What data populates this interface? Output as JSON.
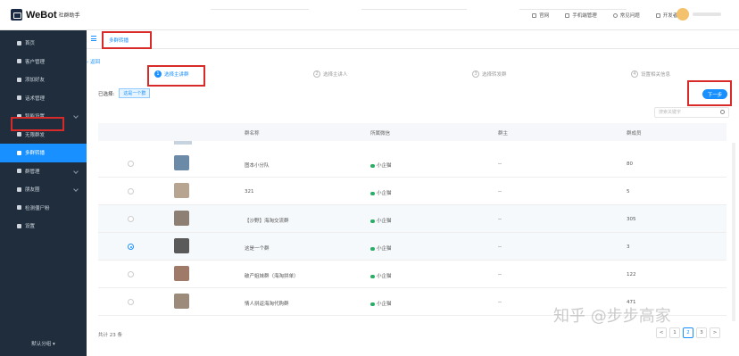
{
  "app": {
    "name": "WeBot",
    "subtitle": "社群助手"
  },
  "top_links": [
    {
      "icon": "monitor-icon",
      "label": "官网"
    },
    {
      "icon": "phone-icon",
      "label": "手机端管理"
    },
    {
      "icon": "question-icon",
      "label": "常见问题"
    },
    {
      "icon": "code-icon",
      "label": "开发者API"
    }
  ],
  "sidebar": {
    "items": [
      {
        "label": "首页",
        "icon": "home-icon",
        "chevron": false
      },
      {
        "label": "客户管理",
        "icon": "user-icon",
        "chevron": false
      },
      {
        "label": "添加好友",
        "icon": "add-friend-icon",
        "chevron": false
      },
      {
        "label": "话术管理",
        "icon": "doc-icon",
        "chevron": false
      },
      {
        "label": "智能设置",
        "icon": "settings-icon",
        "chevron": true
      },
      {
        "label": "无限群发",
        "icon": "send-icon",
        "chevron": false
      },
      {
        "label": "多群转播",
        "icon": "broadcast-icon",
        "chevron": false,
        "active": true
      },
      {
        "label": "群管理",
        "icon": "group-icon",
        "chevron": true
      },
      {
        "label": "朋友圈",
        "icon": "moments-icon",
        "chevron": true
      },
      {
        "label": "检测僵尸粉",
        "icon": "scan-icon",
        "chevron": false
      },
      {
        "label": "设置",
        "icon": "gear-icon",
        "chevron": false
      }
    ],
    "bottom": "默认分组"
  },
  "tab": {
    "label": "多群转播"
  },
  "back_label": "返回",
  "steps": [
    {
      "num": "1",
      "label": "选择主讲群"
    },
    {
      "num": "2",
      "label": "选择主讲人"
    },
    {
      "num": "3",
      "label": "选择转发群"
    },
    {
      "num": "4",
      "label": "设置相关信息"
    }
  ],
  "selected": {
    "label": "已选择:",
    "tag": "这是一个群"
  },
  "next_button": "下一步",
  "search": {
    "placeholder": "搜索关键字"
  },
  "table": {
    "headers": [
      "群名称",
      "所属微信",
      "群主",
      "群成员"
    ],
    "rows": [
      {
        "name": "图本小分队",
        "wechat": "小企猫",
        "owner": "--",
        "members": "80",
        "checked": false,
        "thumb": "#6b8aa8"
      },
      {
        "name": "321",
        "wechat": "小企猫",
        "owner": "--",
        "members": "5",
        "checked": false,
        "thumb": "#b7a592"
      },
      {
        "name": "【沙野】海淘交流群",
        "wechat": "小企猫",
        "owner": "--",
        "members": "305",
        "checked": false,
        "thumb": "#8e7f74"
      },
      {
        "name": "这是一个群",
        "wechat": "小企猫",
        "owner": "--",
        "members": "3",
        "checked": true,
        "thumb": "#5a5a5a"
      },
      {
        "name": "破产姐妹群（海淘拼单）",
        "wechat": "小企猫",
        "owner": "--",
        "members": "122",
        "checked": false,
        "thumb": "#a07a68"
      },
      {
        "name": "情人拼返海淘代购群",
        "wechat": "小企猫",
        "owner": "--",
        "members": "471",
        "checked": false,
        "thumb": "#9c8a7a"
      }
    ]
  },
  "total": "共计 23 条",
  "pager": [
    "<",
    "1",
    "2",
    "3",
    ">"
  ],
  "pager_active": "2",
  "watermark": "知乎 @步步高家"
}
